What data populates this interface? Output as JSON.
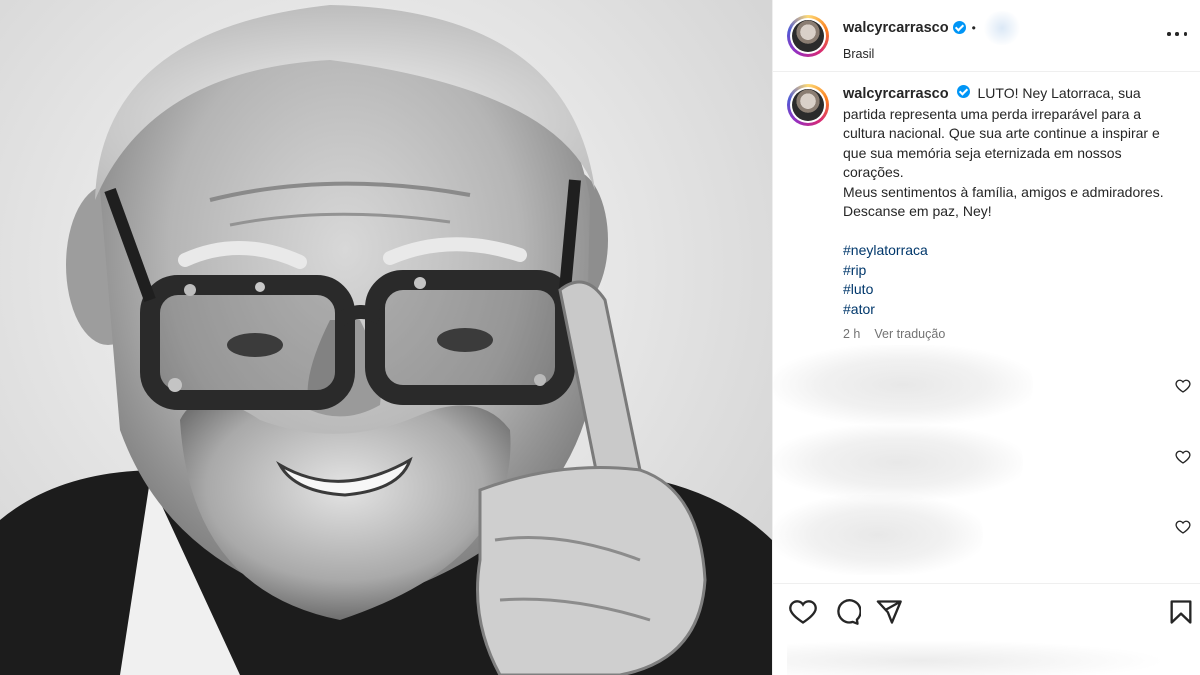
{
  "post": {
    "photo_alt": "",
    "header": {
      "username": "walcyrcarrasco",
      "dot": "•",
      "location": "Brasil"
    },
    "caption": {
      "username": "walcyrcarrasco",
      "text_1": "LUTO! Ney Latorraca, sua partida representa uma perda irreparável para a cultura nacional. Que sua arte continue a inspirar e que sua memória seja eternizada em nossos corações.",
      "text_2": "Meus sentimentos à família, amigos e admiradores. Descanse em paz, Ney!",
      "hashtags": [
        "#neylatorraca",
        "#rip",
        "#luto",
        "#ator"
      ],
      "time": "2 h",
      "translate": "Ver tradução"
    },
    "icons": {
      "verified": "verified-badge-icon",
      "more": "more-options-icon",
      "like": "heart-icon",
      "comment": "comment-icon",
      "share": "share-icon",
      "save": "bookmark-icon"
    },
    "colors": {
      "accent": "#0095f6",
      "hashtag": "#00376b",
      "text": "#262626",
      "muted": "#737373"
    }
  }
}
